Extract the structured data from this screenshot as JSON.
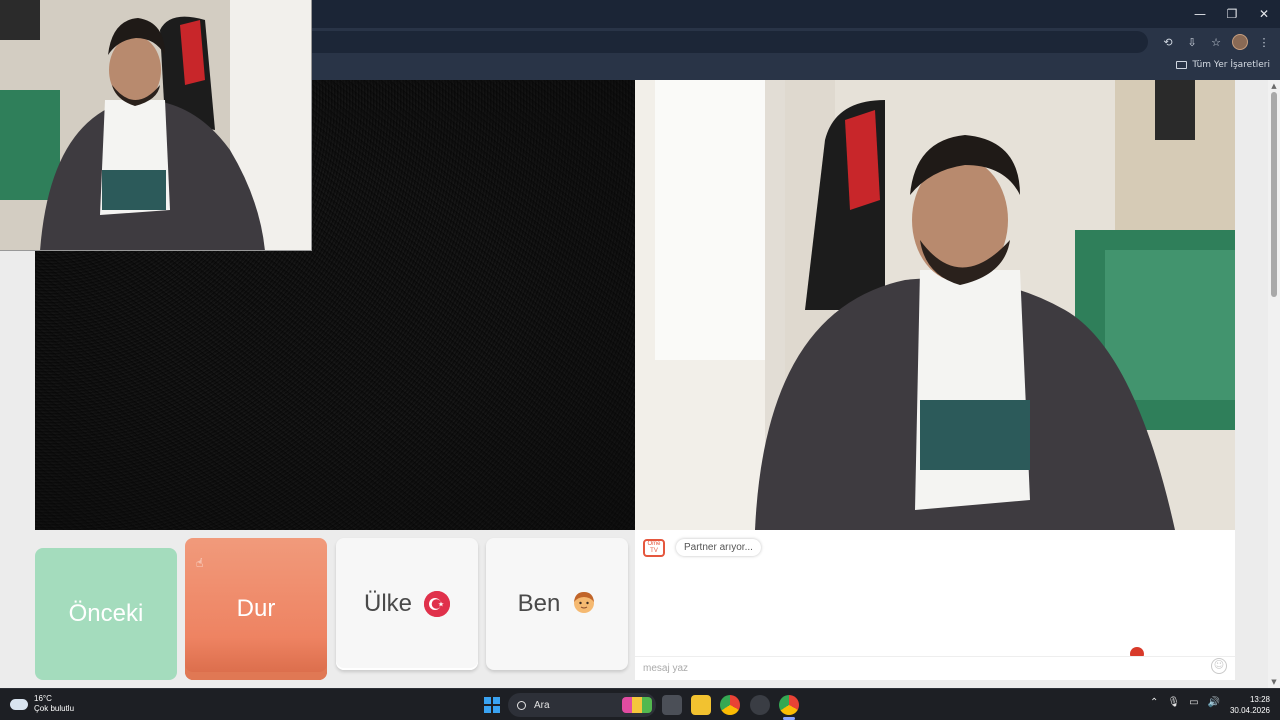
{
  "browser": {
    "window_controls": [
      "—",
      "❐",
      "✕"
    ],
    "bookmarks_all_label": "Tüm Yer İşaretleri"
  },
  "controls": {
    "prev_label": "Önceki",
    "stop_label": "Dur",
    "country_label": "Ülke",
    "me_label": "Ben"
  },
  "chat": {
    "logo_text": "Ome TV",
    "status_message": "Partner arıyor...",
    "input_placeholder": "mesaj yaz"
  },
  "taskbar": {
    "temperature": "16°C",
    "weather_desc": "Çok bulutlu",
    "search_label": "Ara",
    "time": "13:28",
    "date": "30.04.2026"
  },
  "colors": {
    "prev_button": "#a4dcbd",
    "stop_button": "#ee8362",
    "accent": "#e5573e"
  }
}
